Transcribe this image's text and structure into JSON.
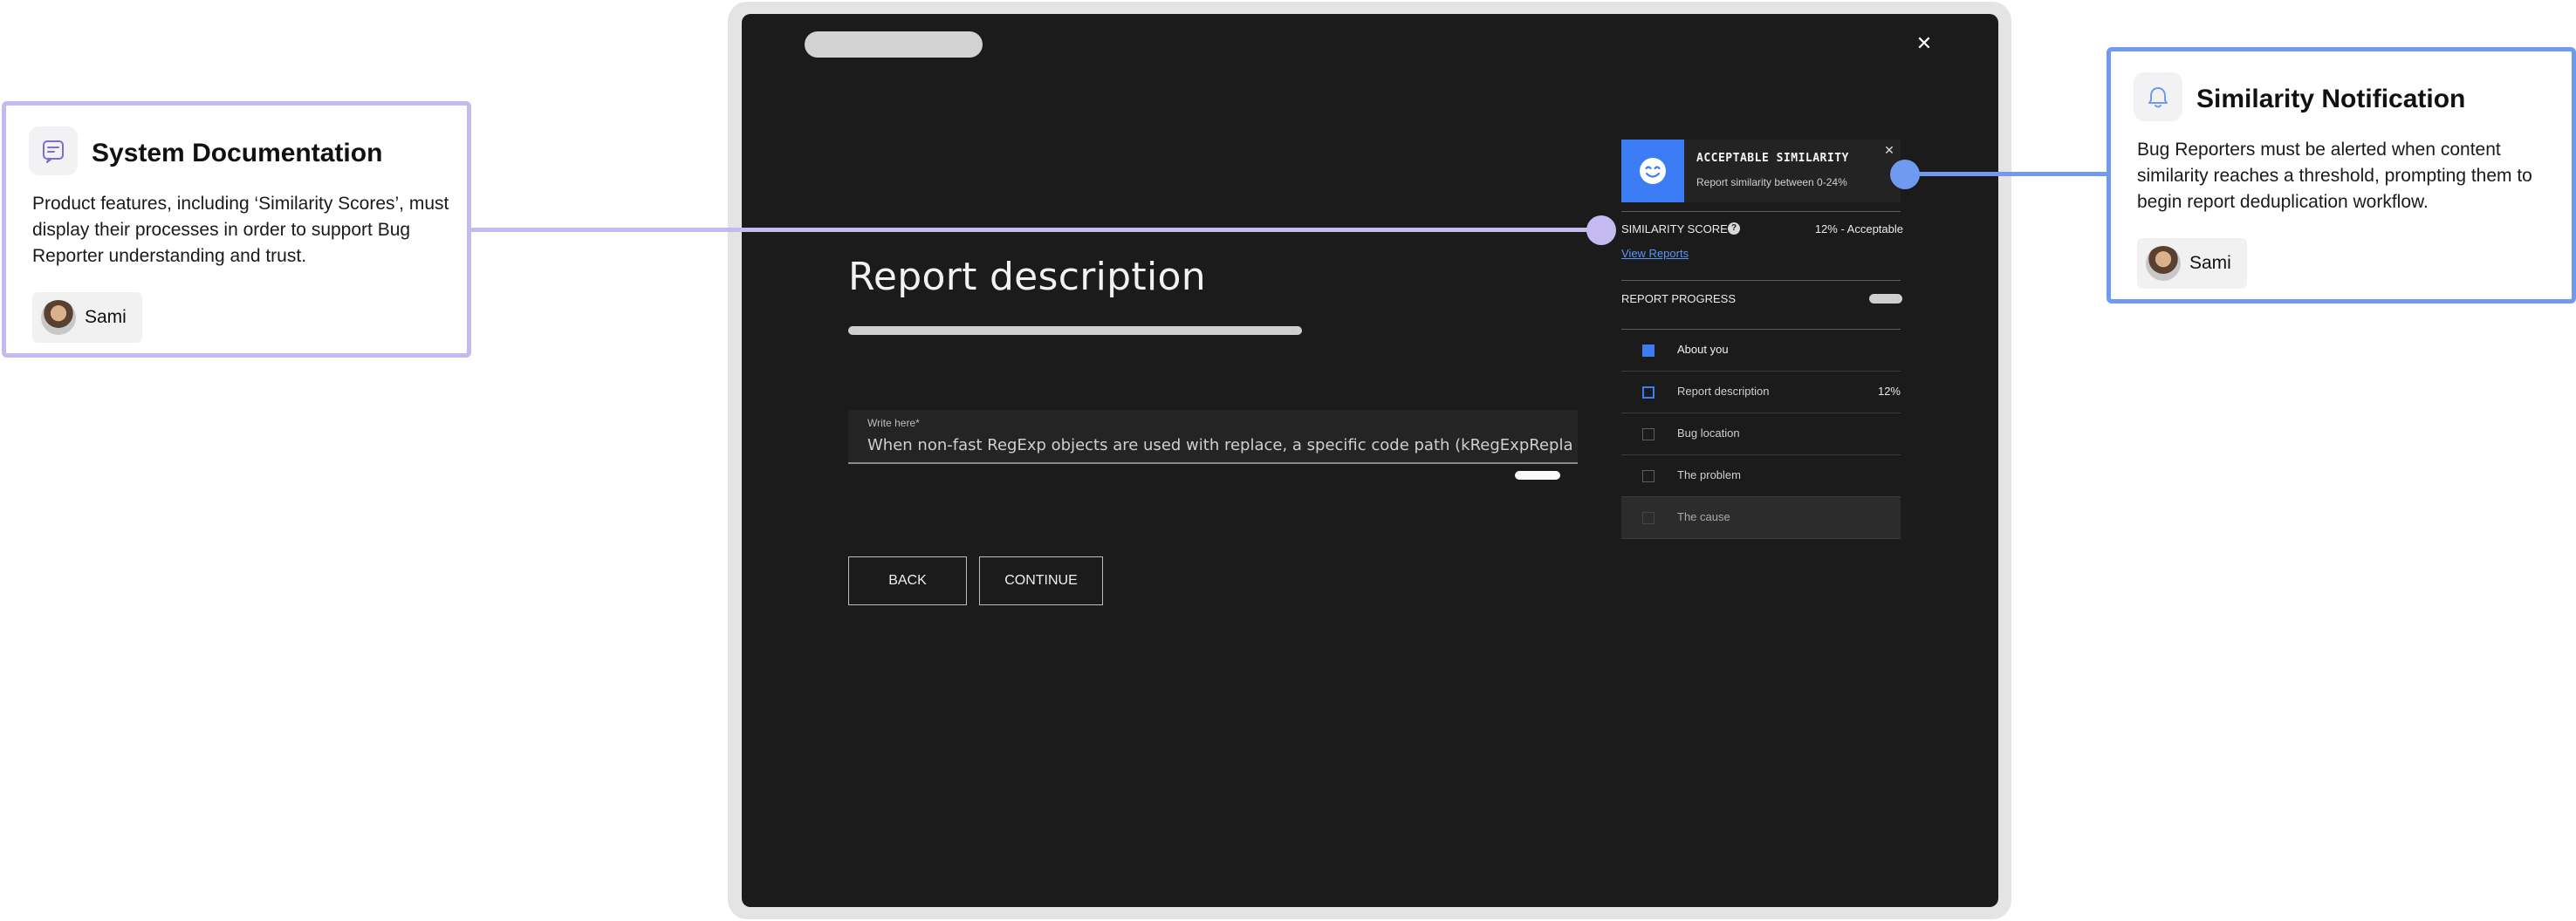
{
  "app": {
    "close_glyph": "✕",
    "page_title": "Report description",
    "field": {
      "label": "Write here*",
      "value": "When non-fast RegExp objects are used with replace, a specific code path (kRegExpRepla"
    },
    "buttons": {
      "back": "BACK",
      "continue": "CONTINUE"
    }
  },
  "notification": {
    "title": "ACCEPTABLE SIMILARITY",
    "text": "Report similarity between 0-24%",
    "close_glyph": "✕",
    "icon": "smiley-face-icon",
    "accent_color": "#3c7df5"
  },
  "similarity": {
    "label": "SIMILARITY SCORE",
    "help_glyph": "?",
    "value": "12% - Acceptable",
    "link": "View Reports"
  },
  "progress": {
    "label": "REPORT PROGRESS",
    "steps": [
      {
        "label": "About you",
        "state": "complete",
        "percent": ""
      },
      {
        "label": "Report description",
        "state": "current",
        "percent": "12%"
      },
      {
        "label": "Bug location",
        "state": "todo",
        "percent": ""
      },
      {
        "label": "The problem",
        "state": "todo",
        "percent": ""
      },
      {
        "label": "The cause",
        "state": "todo",
        "percent": ""
      }
    ]
  },
  "annotations": {
    "left": {
      "title": "System Documentation",
      "body": "Product features, including ‘Similarity Scores’, must display their processes in order to support Bug Reporter understanding and trust.",
      "author": "Sami",
      "icon": "document-chat-icon",
      "color": "#c5b9f2"
    },
    "right": {
      "title": "Similarity Notification",
      "body": "Bug Reporters must be alerted when content similarity reaches a threshold, prompting them to begin report deduplication workflow.",
      "author": "Sami",
      "icon": "bell-icon",
      "color": "#6f9af0"
    }
  }
}
